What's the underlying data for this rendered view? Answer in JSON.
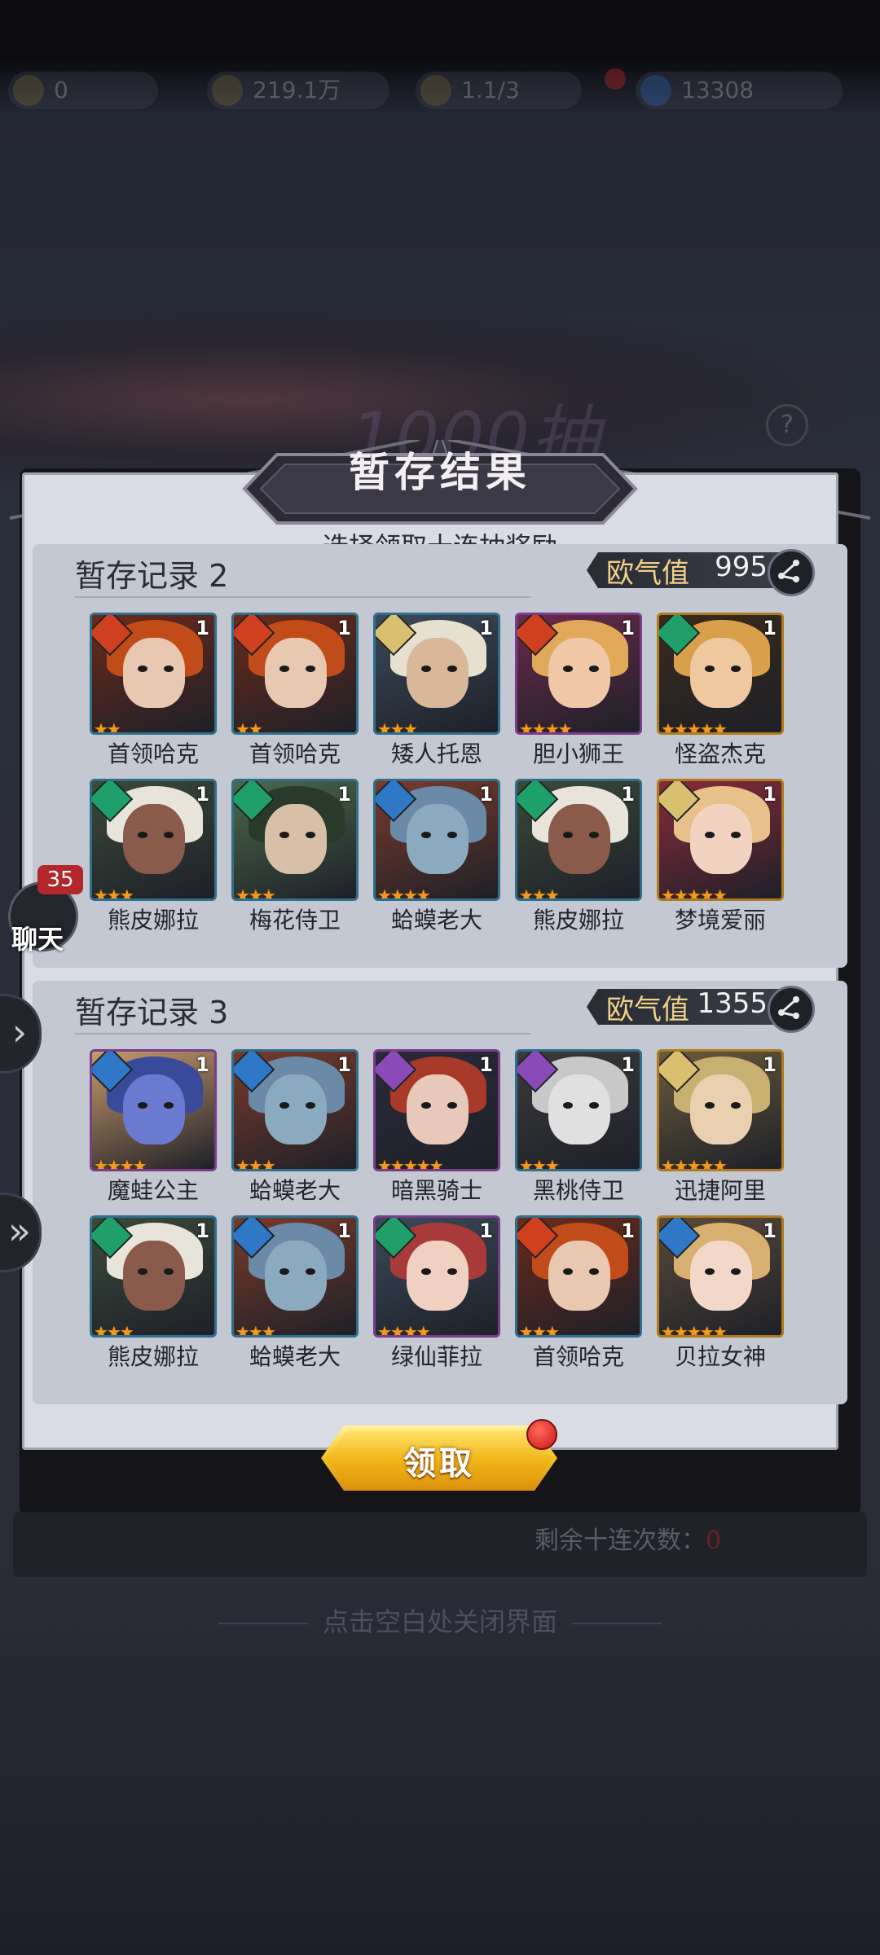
{
  "topbar": {
    "items": [
      {
        "icon": "level-badge-icon",
        "value": "0"
      },
      {
        "icon": "power-icon",
        "value": "219.1万"
      },
      {
        "icon": "stamina-icon",
        "value": "1.1/3"
      },
      {
        "icon": "gem-icon",
        "value": "13308"
      }
    ]
  },
  "background": {
    "title": "1000抽"
  },
  "dialog": {
    "title": "暂存结果",
    "subtitle": "选择领取十连抽奖励",
    "claim_label": "领取",
    "remaining_label": "剩余十连次数：",
    "remaining_value": "0",
    "close_hint": "点击空白处关闭界面"
  },
  "records": [
    {
      "title": "暂存记录 2",
      "luck_label": "欧气值",
      "luck_value": "995",
      "heroes": [
        {
          "name": "首领哈克",
          "element": "fire",
          "count": "1",
          "stars": 2,
          "frame": "#2f6f8c",
          "palette": [
            "#c24b1a",
            "#e8c8b0",
            "#6b2a1a"
          ]
        },
        {
          "name": "首领哈克",
          "element": "fire",
          "count": "1",
          "stars": 2,
          "frame": "#2f6f8c",
          "palette": [
            "#c24b1a",
            "#e8c8b0",
            "#6b2a1a"
          ]
        },
        {
          "name": "矮人托恩",
          "element": "light",
          "count": "1",
          "stars": 3,
          "frame": "#2f6f8c",
          "palette": [
            "#e6e0cf",
            "#d9b89a",
            "#3a4a5a"
          ]
        },
        {
          "name": "胆小狮王",
          "element": "fire",
          "count": "1",
          "stars": 4,
          "frame": "#7a3c8c",
          "palette": [
            "#e1a85a",
            "#f0c8a8",
            "#6a2a4a"
          ]
        },
        {
          "name": "怪盗杰克",
          "element": "wind",
          "count": "1",
          "stars": 5,
          "frame": "#b07a1e",
          "palette": [
            "#d8a04a",
            "#f0c8a0",
            "#3a2a1a"
          ]
        },
        {
          "name": "熊皮娜拉",
          "element": "wind",
          "count": "1",
          "stars": 3,
          "frame": "#2f6f8c",
          "palette": [
            "#e8e4da",
            "#8a5a4a",
            "#3a4a3a"
          ]
        },
        {
          "name": "梅花侍卫",
          "element": "wind",
          "count": "1",
          "stars": 3,
          "frame": "#2f6f8c",
          "palette": [
            "#2a3a2a",
            "#d8c0a8",
            "#4a6a4a"
          ]
        },
        {
          "name": "蛤蟆老大",
          "element": "water",
          "count": "1",
          "stars": 4,
          "frame": "#2f6f8c",
          "palette": [
            "#6a8aa8",
            "#8aaac0",
            "#7a3a2a"
          ]
        },
        {
          "name": "熊皮娜拉",
          "element": "wind",
          "count": "1",
          "stars": 3,
          "frame": "#2f6f8c",
          "palette": [
            "#e8e4da",
            "#8a5a4a",
            "#3a4a3a"
          ]
        },
        {
          "name": "梦境爱丽",
          "element": "light",
          "count": "1",
          "stars": 5,
          "frame": "#b07a1e",
          "palette": [
            "#e8c08a",
            "#f2d2c0",
            "#8a2a3a"
          ]
        }
      ]
    },
    {
      "title": "暂存记录 3",
      "luck_label": "欧气值",
      "luck_value": "1355",
      "heroes": [
        {
          "name": "魔蛙公主",
          "element": "water",
          "count": "1",
          "stars": 4,
          "frame": "#7a3c8c",
          "palette": [
            "#3a4a9a",
            "#6a7ad0",
            "#c89a6a"
          ]
        },
        {
          "name": "蛤蟆老大",
          "element": "water",
          "count": "1",
          "stars": 3,
          "frame": "#2f6f8c",
          "palette": [
            "#6a8aa8",
            "#8aaac0",
            "#7a3a2a"
          ]
        },
        {
          "name": "暗黑骑士",
          "element": "dark",
          "count": "1",
          "stars": 5,
          "frame": "#7a3c8c",
          "palette": [
            "#a83a2a",
            "#e8c8b8",
            "#2a2a3a"
          ]
        },
        {
          "name": "黑桃侍卫",
          "element": "dark",
          "count": "1",
          "stars": 3,
          "frame": "#2f6f8c",
          "palette": [
            "#c8c8c8",
            "#e0e0e0",
            "#3a3a3a"
          ]
        },
        {
          "name": "迅捷阿里",
          "element": "light",
          "count": "1",
          "stars": 5,
          "frame": "#b07a1e",
          "palette": [
            "#c8b070",
            "#e8d0b0",
            "#6a5a3a"
          ]
        },
        {
          "name": "熊皮娜拉",
          "element": "wind",
          "count": "1",
          "stars": 3,
          "frame": "#2f6f8c",
          "palette": [
            "#e8e4da",
            "#8a5a4a",
            "#3a4a3a"
          ]
        },
        {
          "name": "蛤蟆老大",
          "element": "water",
          "count": "1",
          "stars": 3,
          "frame": "#2f6f8c",
          "palette": [
            "#6a8aa8",
            "#8aaac0",
            "#7a3a2a"
          ]
        },
        {
          "name": "绿仙菲拉",
          "element": "wind",
          "count": "1",
          "stars": 4,
          "frame": "#7a3c8c",
          "palette": [
            "#a83a3a",
            "#f0d0c0",
            "#3a4a5a"
          ]
        },
        {
          "name": "首领哈克",
          "element": "fire",
          "count": "1",
          "stars": 3,
          "frame": "#2f6f8c",
          "palette": [
            "#c24b1a",
            "#e8c8b0",
            "#6b2a1a"
          ]
        },
        {
          "name": "贝拉女神",
          "element": "water",
          "count": "1",
          "stars": 5,
          "frame": "#b07a1e",
          "palette": [
            "#d8b070",
            "#f2d8c8",
            "#5a4a3a"
          ]
        }
      ]
    }
  ],
  "chat": {
    "label": "聊天",
    "badge": "35"
  },
  "element_colors": {
    "fire": "#d0401e",
    "water": "#2f78c8",
    "wind": "#1fa06a",
    "light": "#d8c070",
    "dark": "#8a4ab8"
  },
  "element_glyphs": {
    "fire": "火",
    "water": "水",
    "wind": "风",
    "light": "光",
    "dark": "暗"
  }
}
